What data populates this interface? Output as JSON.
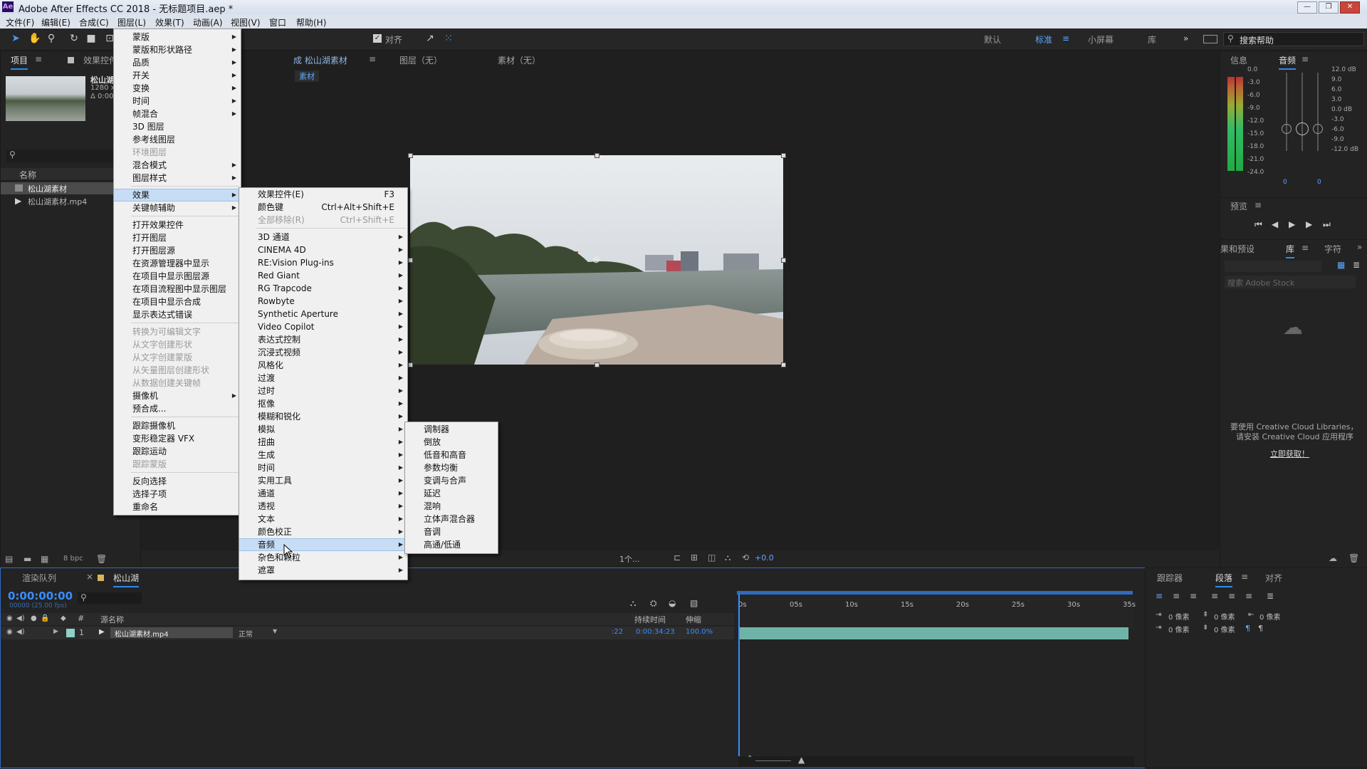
{
  "window": {
    "logo": "Ae",
    "title": "Adobe After Effects CC 2018 - 无标题项目.aep *",
    "controls": [
      "—",
      "❐",
      "✕"
    ]
  },
  "menubar": [
    "文件(F)",
    "编辑(E)",
    "合成(C)",
    "图层(L)",
    "效果(T)",
    "动画(A)",
    "视图(V)",
    "窗口",
    "帮助(H)"
  ],
  "toolbar": {
    "snap_label": "对齐",
    "workspaces": [
      "默认",
      "标准",
      "小屏幕",
      "库"
    ],
    "search_placeholder": "搜索帮助"
  },
  "project_panel": {
    "tab": "项目",
    "tab2": "效果控件 松山",
    "item_name": "松山湖素材",
    "item_meta1": "1280 x 720 (1.00)",
    "item_meta2": "Δ 0:00:34:23, 25.00 fps",
    "col_name": "名称",
    "rows": [
      "松山湖素材",
      "松山湖素材.mp4"
    ],
    "bpc": "8 bpc"
  },
  "comp_panel": {
    "tab_comp": "成 松山湖素材",
    "tab_layer": "图层（无）",
    "tab_footage": "素材（无）",
    "subtab": "素材",
    "zoom_label": "1个...",
    "exposure": "+0.0"
  },
  "info_panel": {
    "tab_info": "信息",
    "tab_audio": "音频",
    "left_scale": [
      "0.0",
      "-3.0",
      "-6.0",
      "-9.0",
      "-12.0",
      "-15.0",
      "-18.0",
      "-21.0",
      "-24.0"
    ],
    "right_scale": [
      "12.0 dB",
      "9.0",
      "6.0",
      "3.0",
      "0.0 dB",
      "-3.0",
      "-6.0",
      "-9.0",
      "-12.0 dB"
    ],
    "bottom_vals": [
      "0",
      "0"
    ]
  },
  "preview_panel": {
    "tab": "预览"
  },
  "library_panel": {
    "tab_effects": "果和预设",
    "tab_lib": "库",
    "tab_char": "字符",
    "search_placeholder": "搜索 Adobe Stock",
    "msg1": "要使用 Creative Cloud Libraries，",
    "msg2": "请安装 Creative Cloud 应用程序",
    "link": "立即获取！"
  },
  "timeline": {
    "tab_render": "渲染队列",
    "tab_comp": "松山湖",
    "timecode": "0:00:00:00",
    "fps": "00000 (25.00 fps)",
    "col_source": "源名称",
    "col_duration": "持续时间",
    "col_stretch": "伸缩",
    "layer_num": "1",
    "layer_name": "松山湖素材.mp4",
    "layer_mode": "正常",
    "layer_in": ":22",
    "layer_dur": "0:00:34:23",
    "layer_stretch": "100.0%",
    "ruler": [
      "0s",
      "05s",
      "10s",
      "15s",
      "20s",
      "25s",
      "30s",
      "35s"
    ]
  },
  "para_panel": {
    "tab_tracker": "跟踪器",
    "tab_para": "段落",
    "tab_align": "对齐",
    "px": "0 像素"
  },
  "layer_menu": [
    {
      "label": "蒙版",
      "sub": true
    },
    {
      "label": "蒙版和形状路径",
      "sub": true
    },
    {
      "label": "品质",
      "sub": true
    },
    {
      "label": "开关",
      "sub": true
    },
    {
      "label": "变换",
      "sub": true
    },
    {
      "label": "时间",
      "sub": true
    },
    {
      "label": "帧混合",
      "sub": true
    },
    {
      "label": "3D 图层"
    },
    {
      "label": "参考线图层"
    },
    {
      "label": "环境图层",
      "disabled": true
    },
    {
      "label": "混合模式",
      "sub": true
    },
    {
      "label": "图层样式",
      "sub": true
    },
    {
      "sep": true
    },
    {
      "label": "效果",
      "sub": true,
      "hl": true
    },
    {
      "label": "关键帧辅助",
      "sub": true
    },
    {
      "sep": true
    },
    {
      "label": "打开效果控件"
    },
    {
      "label": "打开图层"
    },
    {
      "label": "打开图层源"
    },
    {
      "label": "在资源管理器中显示"
    },
    {
      "label": "在项目中显示图层源"
    },
    {
      "label": "在项目流程图中显示图层"
    },
    {
      "label": "在项目中显示合成"
    },
    {
      "label": "显示表达式错误"
    },
    {
      "sep": true
    },
    {
      "label": "转换为可编辑文字",
      "disabled": true
    },
    {
      "label": "从文字创建形状",
      "disabled": true
    },
    {
      "label": "从文字创建蒙版",
      "disabled": true
    },
    {
      "label": "从矢量图层创建形状",
      "disabled": true
    },
    {
      "label": "从数据创建关键帧",
      "disabled": true
    },
    {
      "label": "摄像机",
      "sub": true
    },
    {
      "label": "预合成..."
    },
    {
      "sep": true
    },
    {
      "label": "跟踪摄像机"
    },
    {
      "label": "变形稳定器 VFX"
    },
    {
      "label": "跟踪运动"
    },
    {
      "label": "跟踪蒙版",
      "disabled": true
    },
    {
      "sep": true
    },
    {
      "label": "反向选择"
    },
    {
      "label": "选择子项"
    },
    {
      "label": "重命名"
    }
  ],
  "effect_menu": [
    {
      "label": "效果控件(E)",
      "shortcut": "F3"
    },
    {
      "label": "颜色键",
      "shortcut": "Ctrl+Alt+Shift+E"
    },
    {
      "label": "全部移除(R)",
      "shortcut": "Ctrl+Shift+E",
      "disabled": true
    },
    {
      "sep": true
    },
    {
      "label": "3D 通道",
      "sub": true
    },
    {
      "label": "CINEMA 4D",
      "sub": true
    },
    {
      "label": "RE:Vision Plug-ins",
      "sub": true
    },
    {
      "label": "Red Giant",
      "sub": true
    },
    {
      "label": "RG Trapcode",
      "sub": true
    },
    {
      "label": "Rowbyte",
      "sub": true
    },
    {
      "label": "Synthetic Aperture",
      "sub": true
    },
    {
      "label": "Video Copilot",
      "sub": true
    },
    {
      "label": "表达式控制",
      "sub": true
    },
    {
      "label": "沉浸式视频",
      "sub": true
    },
    {
      "label": "风格化",
      "sub": true
    },
    {
      "label": "过渡",
      "sub": true
    },
    {
      "label": "过时",
      "sub": true
    },
    {
      "label": "抠像",
      "sub": true
    },
    {
      "label": "模糊和锐化",
      "sub": true
    },
    {
      "label": "模拟",
      "sub": true
    },
    {
      "label": "扭曲",
      "sub": true
    },
    {
      "label": "生成",
      "sub": true
    },
    {
      "label": "时间",
      "sub": true
    },
    {
      "label": "实用工具",
      "sub": true
    },
    {
      "label": "通道",
      "sub": true
    },
    {
      "label": "透视",
      "sub": true
    },
    {
      "label": "文本",
      "sub": true
    },
    {
      "label": "颜色校正",
      "sub": true
    },
    {
      "label": "音频",
      "sub": true,
      "hl": true
    },
    {
      "label": "杂色和颗粒",
      "sub": true
    },
    {
      "label": "遮罩",
      "sub": true
    }
  ],
  "audio_menu": [
    {
      "label": "调制器"
    },
    {
      "label": "倒放"
    },
    {
      "label": "低音和高音"
    },
    {
      "label": "参数均衡"
    },
    {
      "label": "变调与合声"
    },
    {
      "label": "延迟"
    },
    {
      "label": "混响"
    },
    {
      "label": "立体声混合器"
    },
    {
      "label": "音调"
    },
    {
      "label": "高通/低通"
    }
  ]
}
